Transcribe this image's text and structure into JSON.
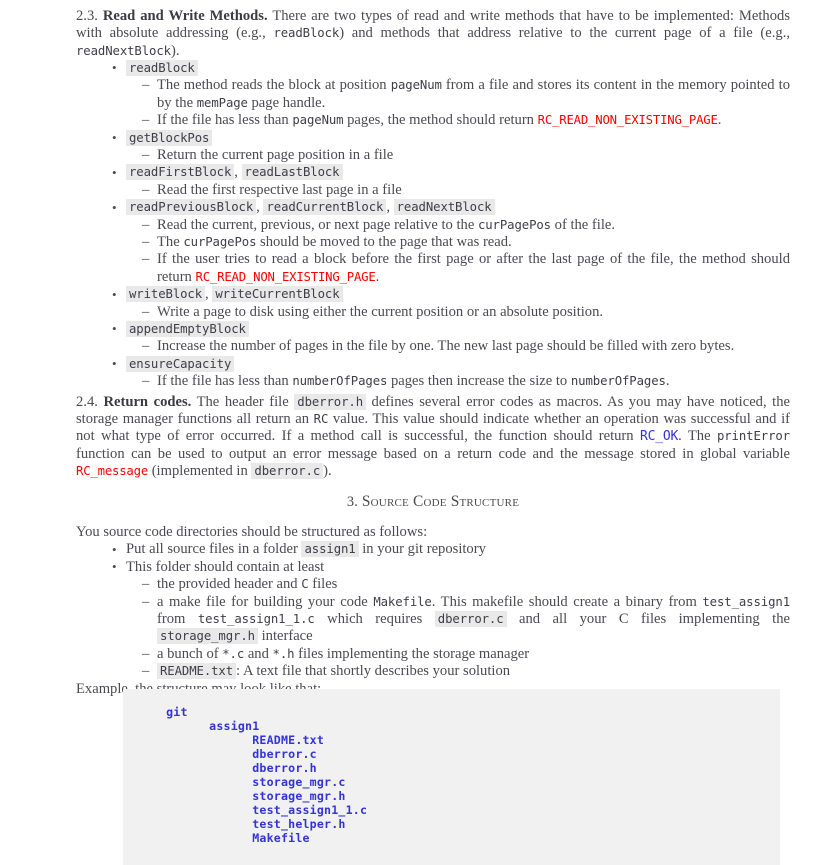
{
  "document": {
    "sections": [
      {
        "number": "2.3.",
        "title": "Read and Write Methods.",
        "body_1": " There are two types of read and write methods that have to be implemented: Methods with absolute addressing (e.g., ",
        "code_1": "readBlock",
        "body_2": ") and methods that address relative to the current page of a file (e.g., ",
        "code_2": "readNextBlock",
        "body_3": ")."
      }
    ],
    "method_list": [
      {
        "names": [
          "readBlock"
        ],
        "details": [
          {
            "parts": [
              {
                "t": "text",
                "v": "The method reads the block at position "
              },
              {
                "t": "tt",
                "v": "pageNum"
              },
              {
                "t": "text",
                "v": " from a file and stores its content in the memory pointed to by the "
              },
              {
                "t": "tt",
                "v": "memPage"
              },
              {
                "t": "text",
                "v": " page handle."
              }
            ]
          },
          {
            "parts": [
              {
                "t": "text",
                "v": "If the file has less than "
              },
              {
                "t": "tt",
                "v": "pageNum"
              },
              {
                "t": "text",
                "v": " pages, the method should return "
              },
              {
                "t": "red",
                "v": "RC_READ_NON_EXISTING_PAGE"
              },
              {
                "t": "text",
                "v": "."
              }
            ]
          }
        ]
      },
      {
        "names": [
          "getBlockPos"
        ],
        "details": [
          {
            "parts": [
              {
                "t": "text",
                "v": "Return the current page position in a file"
              }
            ]
          }
        ]
      },
      {
        "names": [
          "readFirstBlock",
          "readLastBlock"
        ],
        "details": [
          {
            "parts": [
              {
                "t": "text",
                "v": "Read the first respective last page in a file"
              }
            ]
          }
        ]
      },
      {
        "names": [
          "readPreviousBlock",
          "readCurrentBlock",
          "readNextBlock"
        ],
        "details": [
          {
            "parts": [
              {
                "t": "text",
                "v": "Read the current, previous, or next page relative to the "
              },
              {
                "t": "tt",
                "v": "curPagePos"
              },
              {
                "t": "text",
                "v": " of the file."
              }
            ]
          },
          {
            "parts": [
              {
                "t": "text",
                "v": "The "
              },
              {
                "t": "tt",
                "v": "curPagePos"
              },
              {
                "t": "text",
                "v": " should be moved to the page that was read."
              }
            ]
          },
          {
            "parts": [
              {
                "t": "text",
                "v": "If the user tries to read a block before the first page or after the last page of the file, the method should return "
              },
              {
                "t": "red",
                "v": "RC_READ_NON_EXISTING_PAGE"
              },
              {
                "t": "text",
                "v": "."
              }
            ]
          }
        ]
      },
      {
        "names": [
          "writeBlock",
          "writeCurrentBlock"
        ],
        "details": [
          {
            "parts": [
              {
                "t": "text",
                "v": "Write a page to disk using either the current position or an absolute position."
              }
            ]
          }
        ]
      },
      {
        "names": [
          "appendEmptyBlock"
        ],
        "details": [
          {
            "parts": [
              {
                "t": "text",
                "v": "Increase the number of pages in the file by one. The new last page should be filled with zero bytes."
              }
            ]
          }
        ]
      },
      {
        "names": [
          "ensureCapacity"
        ],
        "details": [
          {
            "parts": [
              {
                "t": "text",
                "v": "If the file has less than "
              },
              {
                "t": "tt",
                "v": "numberOfPages"
              },
              {
                "t": "text",
                "v": " pages then increase the size to "
              },
              {
                "t": "tt",
                "v": "numberOfPages"
              },
              {
                "t": "text",
                "v": "."
              }
            ]
          }
        ]
      }
    ],
    "return_codes": {
      "number": "2.4.",
      "title": "Return codes.",
      "t1": " The header file ",
      "code1": "dberror.h",
      "t2": " defines several error codes as macros. As you may have noticed, the storage manager functions all return an ",
      "tt1": "RC",
      "t3": " value. This value should indicate whether an operation was successful and if not what type of error occurred. If a method call is successful, the function should return ",
      "blue1": "RC_OK",
      "t4": ". The ",
      "tt2": "printError",
      "t5": " function can be used to output an error message based on a return code and the message stored in global variable ",
      "red1": "RC_message",
      "t6": " (implemented in ",
      "code2": "dberror.c",
      "t7": ")."
    },
    "source_section": {
      "number": "3.",
      "title": "Source Code Structure",
      "intro": "You source code directories should be structured as follows:",
      "bullets": [
        {
          "parts": [
            {
              "t": "text",
              "v": "Put all source files in a folder "
            },
            {
              "t": "code",
              "v": "assign1"
            },
            {
              "t": "text",
              "v": " in your git repository"
            }
          ]
        },
        {
          "parts": [
            {
              "t": "text",
              "v": "This folder should contain at least"
            }
          ]
        }
      ],
      "sub_items": [
        {
          "parts": [
            {
              "t": "text",
              "v": "the provided header and "
            },
            {
              "t": "tt",
              "v": "C"
            },
            {
              "t": "text",
              "v": " files"
            }
          ]
        },
        {
          "parts": [
            {
              "t": "text",
              "v": "a make file for building your code "
            },
            {
              "t": "tt",
              "v": "Makefile"
            },
            {
              "t": "text",
              "v": ". This makefile should create a binary from "
            },
            {
              "t": "tt",
              "v": "test_assign1"
            },
            {
              "t": "text",
              "v": " from "
            },
            {
              "t": "tt",
              "v": "test_assign1_1.c"
            },
            {
              "t": "text",
              "v": " which requires "
            },
            {
              "t": "code",
              "v": "dberror.c"
            },
            {
              "t": "text",
              "v": " and all your C files implementing the "
            },
            {
              "t": "code",
              "v": "storage_mgr.h"
            },
            {
              "t": "text",
              "v": " interface"
            }
          ]
        },
        {
          "parts": [
            {
              "t": "text",
              "v": "a bunch of "
            },
            {
              "t": "tt",
              "v": "*.c"
            },
            {
              "t": "text",
              "v": " and "
            },
            {
              "t": "tt",
              "v": "*.h"
            },
            {
              "t": "text",
              "v": " files implementing the storage manager"
            }
          ]
        },
        {
          "parts": [
            {
              "t": "code",
              "v": "README.txt"
            },
            {
              "t": "text",
              "v": ": A text file that shortly describes your solution"
            }
          ]
        }
      ],
      "example_caption": "Example, the structure may look like that:"
    },
    "code_block": {
      "lines": [
        "      git",
        "            assign1",
        "                  README.txt",
        "                  dberror.c",
        "                  dberror.h",
        "                  storage_mgr.c",
        "                  storage_mgr.h",
        "                  test_assign1_1.c",
        "                  test_helper.h",
        "                  Makefile"
      ]
    },
    "colors": {
      "error_red": "#ff0000",
      "link_blue": "#3434d6",
      "code_bg": "#e9e9e9",
      "block_bg": "#f1f1f1",
      "text": "#4a4a52"
    }
  }
}
